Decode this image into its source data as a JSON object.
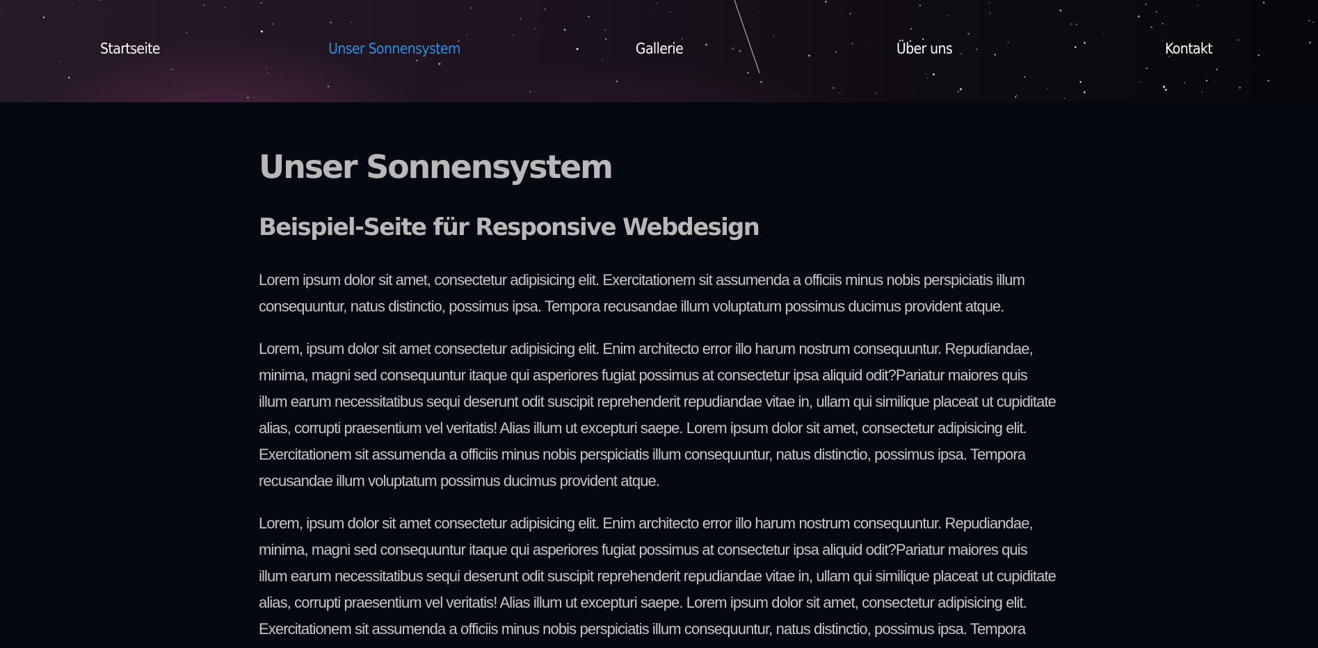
{
  "nav": {
    "items": [
      {
        "label": "Startseite",
        "active": false
      },
      {
        "label": "Unser Sonnensystem",
        "active": true
      },
      {
        "label": "Gallerie",
        "active": false
      },
      {
        "label": "Über uns",
        "active": false
      },
      {
        "label": "Kontakt",
        "active": false
      }
    ],
    "active_color": "#2f8fe0",
    "text_color": "#ffffff"
  },
  "main": {
    "title": "Unser Sonnensystem",
    "subtitle": "Beispiel-Seite für Responsive Webdesign",
    "paragraphs": [
      "Lorem ipsum dolor sit amet, consectetur adipisicing elit. Exercitationem sit assumenda a officiis minus nobis perspiciatis illum consequuntur, natus distinctio, possimus ipsa. Tempora recusandae illum voluptatum possimus ducimus provident atque.",
      "Lorem, ipsum dolor sit amet consectetur adipisicing elit. Enim architecto error illo harum nostrum consequuntur. Repudiandae, minima, magni sed consequuntur itaque qui asperiores fugiat possimus at consectetur ipsa aliquid odit?Pariatur maiores quis illum earum necessitatibus sequi deserunt odit suscipit reprehenderit repudiandae vitae in, ullam qui similique placeat ut cupiditate alias, corrupti praesentium vel veritatis! Alias illum ut excepturi saepe. Lorem ipsum dolor sit amet, consectetur adipisicing elit. Exercitationem sit assumenda a officiis minus nobis perspiciatis illum consequuntur, natus distinctio, possimus ipsa. Tempora recusandae illum voluptatum possimus ducimus provident atque.",
      "Lorem, ipsum dolor sit amet consectetur adipisicing elit. Enim architecto error illo harum nostrum consequuntur. Repudiandae, minima, magni sed consequuntur itaque qui asperiores fugiat possimus at consectetur ipsa aliquid odit?Pariatur maiores quis illum earum necessitatibus sequi deserunt odit suscipit reprehenderit repudiandae vitae in, ullam qui similique placeat ut cupiditate alias, corrupti praesentium vel veritatis! Alias illum ut excepturi saepe. Lorem ipsum dolor sit amet, consectetur adipisicing elit. Exercitationem sit assumenda a officiis minus nobis perspiciatis illum consequuntur, natus distinctio, possimus ipsa. Tempora"
    ]
  },
  "colors": {
    "page_background": "#040810",
    "heading": "#b8b8b8",
    "body_text": "#c6c6c6"
  }
}
